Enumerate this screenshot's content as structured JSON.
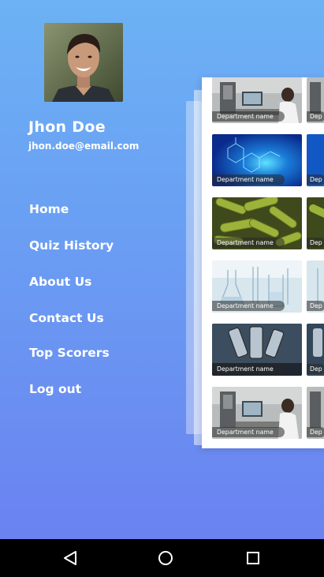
{
  "user": {
    "name": "Jhon Doe",
    "email": "jhon.doe@email.com"
  },
  "menu": {
    "items": [
      {
        "label": "Home",
        "icon": "none"
      },
      {
        "label": "Quiz History",
        "icon": "none"
      },
      {
        "label": "About Us",
        "icon": "none"
      },
      {
        "label": "Contact Us",
        "icon": "none"
      },
      {
        "label": "Top Scorers",
        "icon": "none"
      },
      {
        "label": "Log out",
        "icon": "none"
      }
    ]
  },
  "departments": {
    "tiles": [
      {
        "label": "Department name",
        "image": "scientist-microscope-photo"
      },
      {
        "label": "Department name",
        "image": "blue-molecule-photo"
      },
      {
        "label": "Department name",
        "image": "green-bacteria-photo"
      },
      {
        "label": "Department name",
        "image": "lab-glassware-photo"
      },
      {
        "label": "Department name",
        "image": "microscope-lenses-photo"
      },
      {
        "label": "Department name",
        "image": "scientist-microscope-photo"
      }
    ],
    "partial_label": "Dep"
  },
  "navbar": {
    "back": "back-icon",
    "home": "home-circle-icon",
    "recents": "recents-square-icon"
  },
  "colors": {
    "background_top": "#6cb2f4",
    "background_bottom": "#6a7ff0",
    "text": "#ffffff",
    "navbar": "#000000"
  }
}
